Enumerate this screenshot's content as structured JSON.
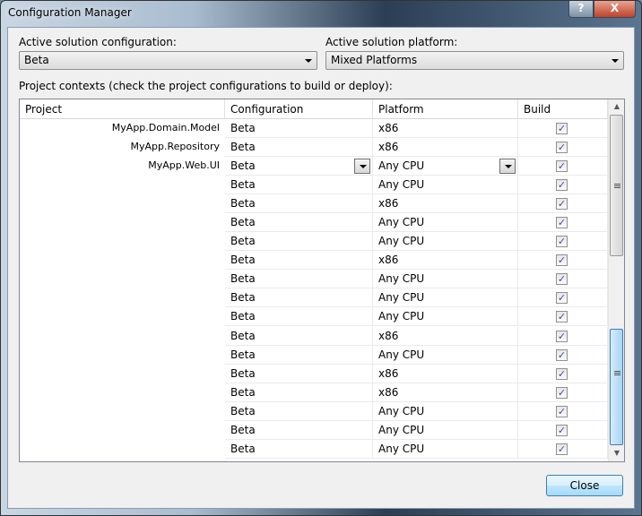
{
  "window": {
    "title": "Configuration Manager",
    "help_label": "?",
    "close_label": "X"
  },
  "active_config": {
    "label": "Active solution configuration:",
    "value": "Beta"
  },
  "active_platform": {
    "label": "Active solution platform:",
    "value": "Mixed Platforms"
  },
  "contexts_label": "Project contexts (check the project configurations to build or deploy):",
  "columns": [
    "Project",
    "Configuration",
    "Platform",
    "Build"
  ],
  "rows": [
    {
      "project": "MyApp.Domain.Model",
      "configuration": "Beta",
      "platform": "x86",
      "build": true
    },
    {
      "project": "MyApp.Repository",
      "configuration": "Beta",
      "platform": "x86",
      "build": true
    },
    {
      "project": "MyApp.Web.UI",
      "configuration": "Beta",
      "platform": "Any CPU",
      "build": true
    },
    {
      "project": "",
      "configuration": "Beta",
      "platform": "Any CPU",
      "build": true
    },
    {
      "project": "",
      "configuration": "Beta",
      "platform": "x86",
      "build": true
    },
    {
      "project": "",
      "configuration": "Beta",
      "platform": "Any CPU",
      "build": true
    },
    {
      "project": "",
      "configuration": "Beta",
      "platform": "Any CPU",
      "build": true
    },
    {
      "project": "",
      "configuration": "Beta",
      "platform": "x86",
      "build": true
    },
    {
      "project": "",
      "configuration": "Beta",
      "platform": "Any CPU",
      "build": true
    },
    {
      "project": "",
      "configuration": "Beta",
      "platform": "Any CPU",
      "build": true
    },
    {
      "project": "",
      "configuration": "Beta",
      "platform": "Any CPU",
      "build": true
    },
    {
      "project": "",
      "configuration": "Beta",
      "platform": "x86",
      "build": true
    },
    {
      "project": "",
      "configuration": "Beta",
      "platform": "Any CPU",
      "build": true
    },
    {
      "project": "",
      "configuration": "Beta",
      "platform": "x86",
      "build": true
    },
    {
      "project": "",
      "configuration": "Beta",
      "platform": "x86",
      "build": true
    },
    {
      "project": "",
      "configuration": "Beta",
      "platform": "Any CPU",
      "build": true
    },
    {
      "project": "",
      "configuration": "Beta",
      "platform": "Any CPU",
      "build": true
    },
    {
      "project": "",
      "configuration": "Beta",
      "platform": "Any CPU",
      "build": true
    }
  ],
  "close_button": "Close"
}
